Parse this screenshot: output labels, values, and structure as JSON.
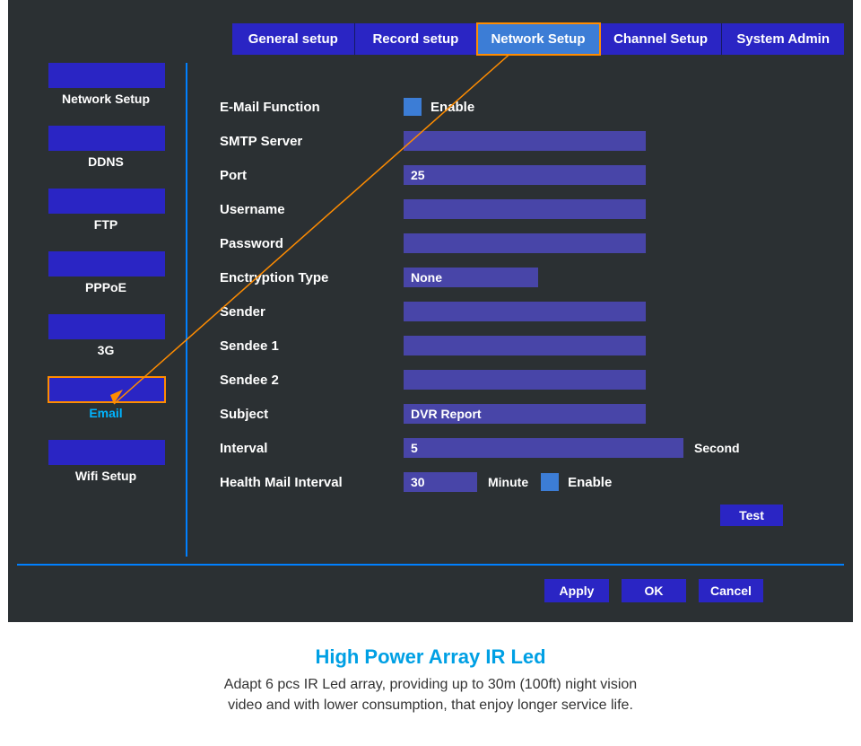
{
  "tabs": {
    "general": "General setup",
    "record": "Record setup",
    "network": "Network Setup",
    "channel": "Channel Setup",
    "system": "System Admin"
  },
  "sidebar": {
    "network": "Network  Setup",
    "ddns": "DDNS",
    "ftp": "FTP",
    "pppoe": "PPPoE",
    "three_g": "3G",
    "email": "Email",
    "wifi": "Wifi Setup"
  },
  "form": {
    "email_function_label": "E-Mail Function",
    "enable_label": "Enable",
    "smtp_label": "SMTP Server",
    "smtp_value": "",
    "port_label": "Port",
    "port_value": "25",
    "username_label": "Username",
    "username_value": "",
    "password_label": "Password",
    "password_value": "",
    "encryption_label": "Enctryption Type",
    "encryption_value": "None",
    "sender_label": "Sender",
    "sender_value": "",
    "sendee1_label": "Sendee 1",
    "sendee1_value": "",
    "sendee2_label": "Sendee 2",
    "sendee2_value": "",
    "subject_label": "Subject",
    "subject_value": "DVR Report",
    "interval_label": "Interval",
    "interval_value": "5",
    "interval_unit": "Second",
    "health_label": "Health Mail Interval",
    "health_value": "30",
    "health_unit": "Minute",
    "health_enable": "Enable",
    "test_btn": "Test"
  },
  "footer": {
    "apply": "Apply",
    "ok": "OK",
    "cancel": "Cancel"
  },
  "promo": {
    "title": "High Power Array IR Led",
    "line1": "Adapt 6 pcs IR Led array, providing up to 30m (100ft) night vision",
    "line2": "video and with lower consumption, that enjoy longer service life."
  }
}
